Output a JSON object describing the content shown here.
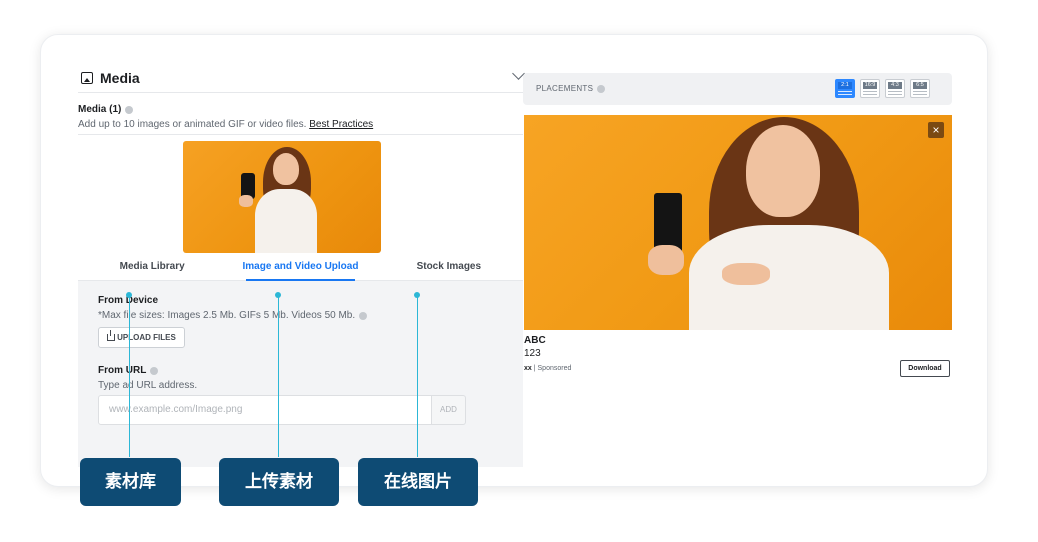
{
  "media_panel": {
    "title": "Media",
    "count_label": "Media (1)",
    "description": "Add up to 10 images or animated GIF or video files.",
    "best_practices_link": "Best Practices",
    "tabs": [
      {
        "label": "Media Library",
        "active": false
      },
      {
        "label": "Image and Video Upload",
        "active": true
      },
      {
        "label": "Stock Images",
        "active": false
      }
    ],
    "from_device_label": "From Device",
    "max_sizes": "*Max file sizes: Images 2.5 Mb. GIFs 5 Mb. Videos 50 Mb.",
    "upload_button": "UPLOAD FILES",
    "from_url_label": "From URL",
    "url_hint": "Type ad URL address.",
    "url_placeholder": "www.example.com/Image.png",
    "add_button": "ADD"
  },
  "preview_panel": {
    "placements_label": "PLACEMENTS",
    "ratios": [
      {
        "label": "2:1",
        "active": true
      },
      {
        "label": "16:9",
        "active": false
      },
      {
        "label": "4:3",
        "active": false
      },
      {
        "label": "6:5",
        "active": false
      }
    ],
    "close_symbol": "×",
    "ad_title": "ABC",
    "ad_subtitle": "123",
    "sponsor_name": "xx",
    "sponsor_suffix": " | Sponsored",
    "download_button": "Download"
  },
  "callouts": [
    {
      "label": "素材库"
    },
    {
      "label": "上传素材"
    },
    {
      "label": "在线图片"
    }
  ],
  "colors": {
    "accent_blue": "#1877f2",
    "callout_bg": "#0e4b74",
    "callout_line": "#2cb7d6",
    "image_bg": "#f19a15"
  }
}
